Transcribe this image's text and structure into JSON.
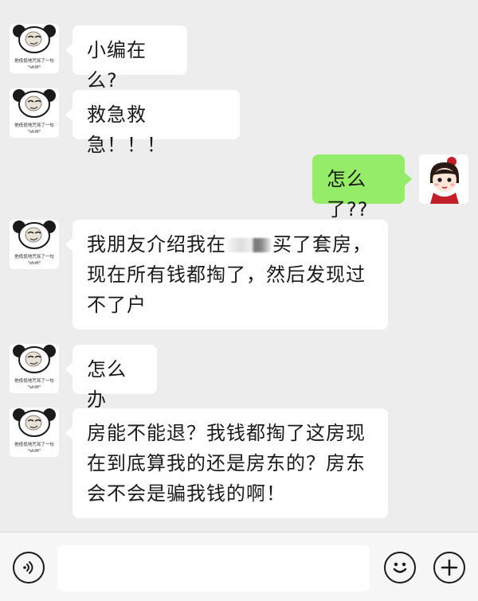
{
  "chat": {
    "messages": [
      {
        "sender": "friend",
        "text": "小编在么?"
      },
      {
        "sender": "friend",
        "text": "救急救急！！！"
      },
      {
        "sender": "me",
        "text": "怎么了??"
      },
      {
        "sender": "friend",
        "text_before_blur": "我朋友介绍我在",
        "text_after_blur": "买了套房，现在所有钱都掏了，然后发现过不了户"
      },
      {
        "sender": "friend",
        "text": "怎么办"
      },
      {
        "sender": "friend",
        "text": "房能不能退？我钱都掏了这房现在到底算我的还是房东的？房东会不会是骗我钱的啊！"
      }
    ],
    "friend_avatar_caption": "他低低地咒骂了一句",
    "friend_avatar_caption2": "\"shift\""
  },
  "input_bar": {
    "voice_icon": "voice-icon",
    "emoji_icon": "smile-icon",
    "plus_icon": "plus-icon",
    "text_value": ""
  }
}
